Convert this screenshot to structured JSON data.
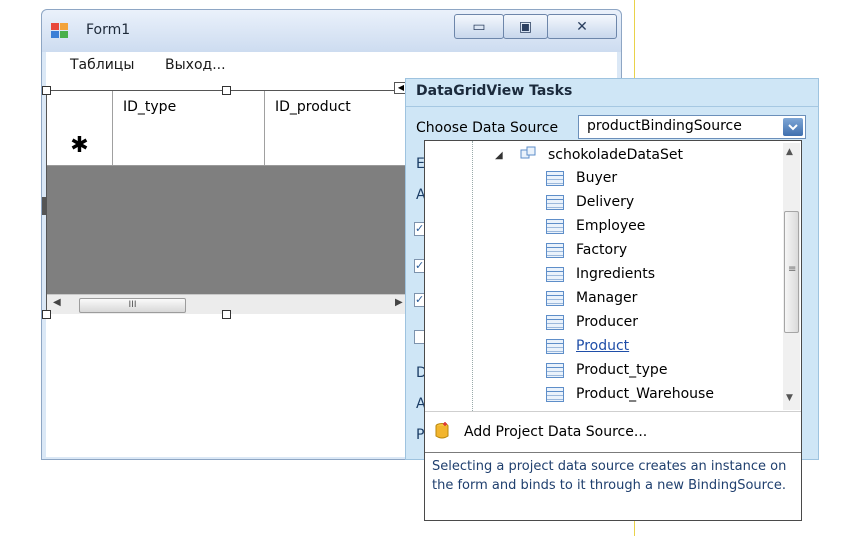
{
  "window": {
    "title": "Form1",
    "minimize_glyph": "▭",
    "maximize_glyph": "▣",
    "close_glyph": "✕"
  },
  "menu": {
    "items": [
      "Таблицы",
      "Выход..."
    ]
  },
  "grid": {
    "columns": [
      "ID_type",
      "ID_product"
    ],
    "new_row_marker": "✱",
    "scroll_left": "◀",
    "scroll_right": "▶",
    "scroll_thumb": "III"
  },
  "tasks_panel": {
    "title": "DataGridView Tasks",
    "choose_label": "Choose Data Source",
    "selected_source": "productBindingSource",
    "hidden_item_initials": [
      "E",
      "A",
      "D",
      "A",
      "P"
    ]
  },
  "dropdown": {
    "dataset": "schokoladeDataSet",
    "tables": [
      "Buyer",
      "Delivery",
      "Employee",
      "Factory",
      "Ingredients",
      "Manager",
      "Producer",
      "Product",
      "Product_type",
      "Product_Warehouse"
    ],
    "selected_table": "Product",
    "add_source_label": "Add Project Data Source...",
    "help_text": "Selecting a project data source creates an instance on the form and binds to it through a new BindingSource."
  },
  "icons": [
    "app-icon",
    "minimize-icon",
    "maximize-icon",
    "close-icon",
    "dataset-icon",
    "table-icon",
    "add-data-source-icon",
    "dropdown-arrow-icon"
  ],
  "colors": {
    "tasks_bg": "#cfe6f6",
    "link": "#1f4ea8",
    "grid_empty": "#7f7f7f"
  }
}
